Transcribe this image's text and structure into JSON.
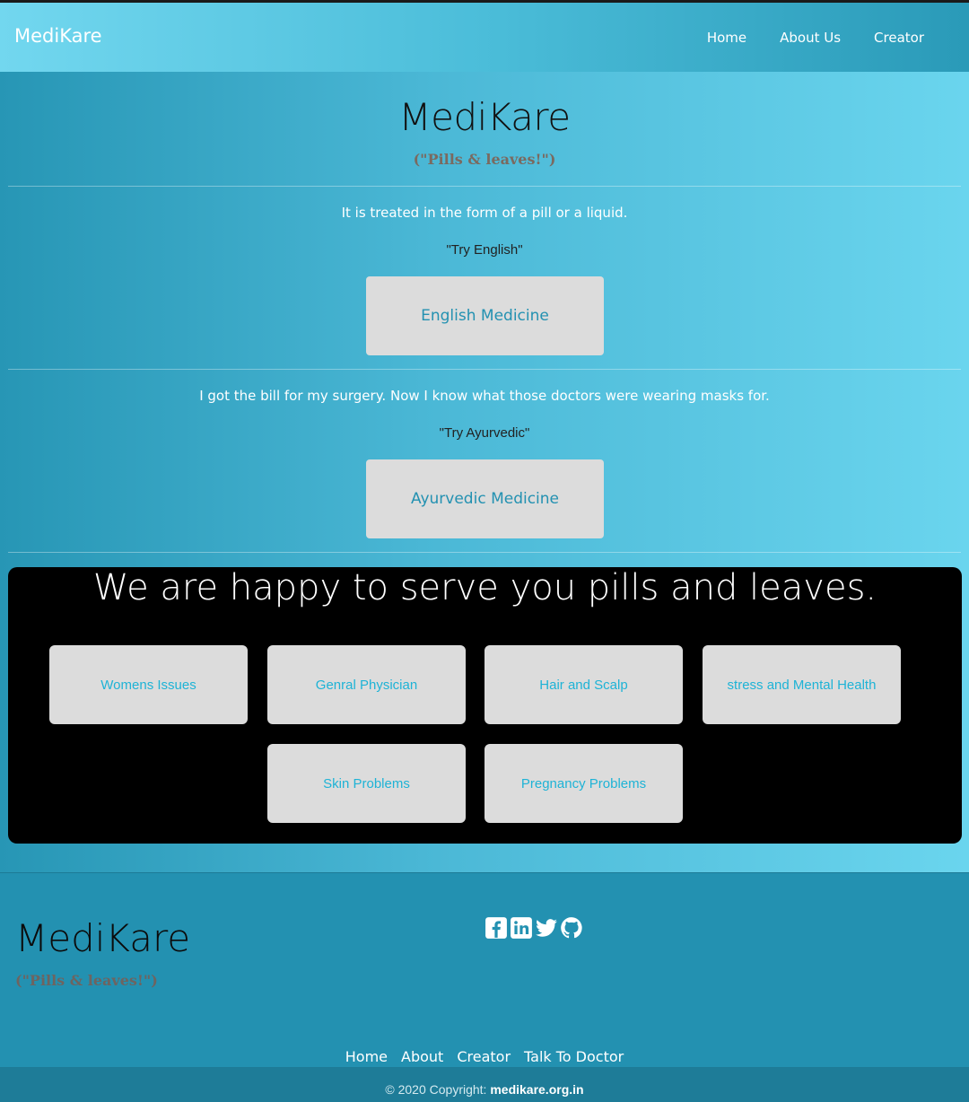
{
  "navbar": {
    "brand": "MediKare",
    "links": [
      "Home",
      "About Us",
      "Creator"
    ]
  },
  "hero": {
    "title": "MediKare",
    "tagline": "(\"Pills & leaves!\")"
  },
  "sections": [
    {
      "text": "It is treated in the form of a pill or a liquid.",
      "quote": "\"Try English\"",
      "button": "English Medicine"
    },
    {
      "text": "I got the bill for my surgery. Now I know what those doctors were wearing masks for.",
      "quote": "\"Try Ayurvedic\"",
      "button": "Ayurvedic Medicine"
    }
  ],
  "panel": {
    "title": "We are happy to serve you pills and leaves.",
    "categories": [
      "Womens Issues",
      "Genral Physician",
      "Hair and Scalp",
      "stress and Mental Health",
      "Skin Problems",
      "Pregnancy Problems"
    ]
  },
  "footer": {
    "title": "MediKare",
    "tagline": "(\"Pills & leaves!\")",
    "social_icons": [
      "facebook-icon",
      "linkedin-icon",
      "twitter-icon",
      "github-icon"
    ],
    "links": [
      "Home",
      "About",
      "Creator",
      "Talk To Doctor"
    ],
    "copyright_prefix": "© 2020 Copyright:",
    "copyright_site": "medikare.org.in"
  },
  "colors": {
    "primary": "#2391b1",
    "button_bg": "#dcdcdc",
    "accent_text": "#1eb3d6"
  }
}
